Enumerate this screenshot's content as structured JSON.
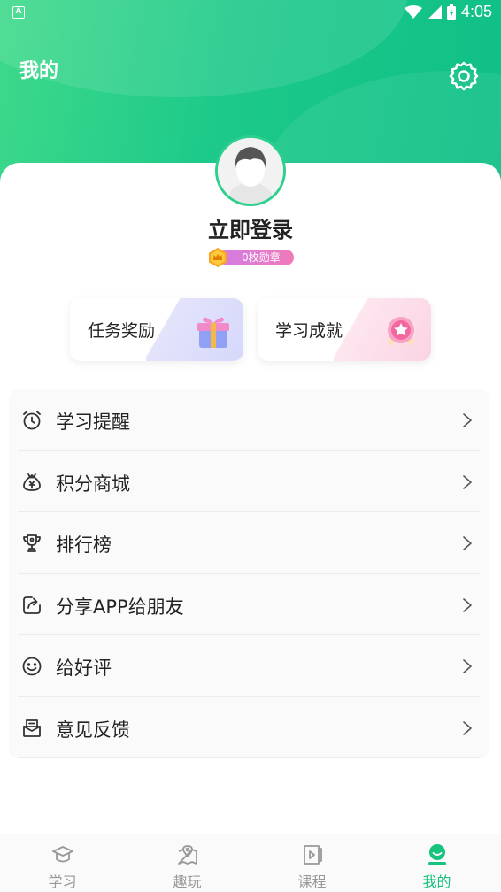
{
  "status_bar": {
    "time": "4:05",
    "app_indicator": "A"
  },
  "header": {
    "title": "我的",
    "settings_icon": "gear-icon"
  },
  "profile": {
    "login_text": "立即登录",
    "badge_text": "0枚勋章",
    "avatar_icon": "default-avatar-icon"
  },
  "tiles": [
    {
      "label": "任务奖励",
      "icon": "gift-icon"
    },
    {
      "label": "学习成就",
      "icon": "medal-icon"
    }
  ],
  "menu": [
    {
      "label": "学习提醒",
      "icon": "alarm-clock-icon"
    },
    {
      "label": "积分商城",
      "icon": "yen-bag-icon"
    },
    {
      "label": "排行榜",
      "icon": "trophy-icon"
    },
    {
      "label": "分享APP给朋友",
      "icon": "share-icon"
    },
    {
      "label": "给好评",
      "icon": "smile-icon"
    },
    {
      "label": "意见反馈",
      "icon": "feedback-icon"
    }
  ],
  "tabs": [
    {
      "label": "学习",
      "icon": "graduation-cap-icon",
      "active": false
    },
    {
      "label": "趣玩",
      "icon": "map-pin-icon",
      "active": false
    },
    {
      "label": "课程",
      "icon": "video-book-icon",
      "active": false
    },
    {
      "label": "我的",
      "icon": "user-icon",
      "active": true
    }
  ],
  "colors": {
    "primary": "#18c37e",
    "header_start": "#3ed98a",
    "header_end": "#0fbf86",
    "badge": "#e07ad0"
  }
}
